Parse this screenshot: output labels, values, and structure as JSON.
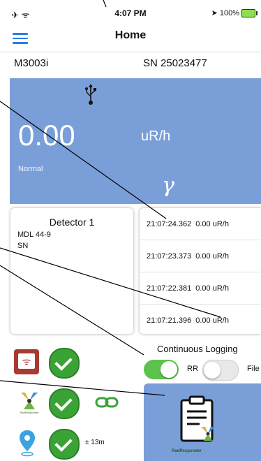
{
  "status_bar": {
    "left_icons": "✈ ᯤ",
    "time": "4:07 PM",
    "battery": "100%",
    "location_arrow": "➤"
  },
  "nav": {
    "title": "Home",
    "menu_icon": "hamburger-menu-icon"
  },
  "device": {
    "model": "M3003i",
    "serial": "SN 25023477"
  },
  "readout": {
    "value": "0.00",
    "unit": "uR/h",
    "status": "Normal",
    "radiation_symbol": "γ",
    "connection_icon": "usb-icon"
  },
  "detector": {
    "title": "Detector 1",
    "mdl": "MDL 44-9",
    "sn": "SN"
  },
  "log": [
    {
      "time": "21:07:24.362",
      "value": "0.00 uR/h"
    },
    {
      "time": "21:07:23.373",
      "value": "0.00 uR/h"
    },
    {
      "time": "21:07:22.381",
      "value": "0.00 uR/h"
    },
    {
      "time": "21:07:21.396",
      "value": "0.00 uR/h"
    }
  ],
  "logging": {
    "label": "Continuous Logging",
    "rr_label": "RR",
    "file_label": "File",
    "rr_on": true,
    "file_on": false
  },
  "gps": {
    "accuracy": "± 13m"
  },
  "report": {
    "label": "RadResponder"
  },
  "colors": {
    "panel_blue": "#7a9fd8",
    "check_green": "#3aa335",
    "menu_blue": "#2a7de1"
  }
}
